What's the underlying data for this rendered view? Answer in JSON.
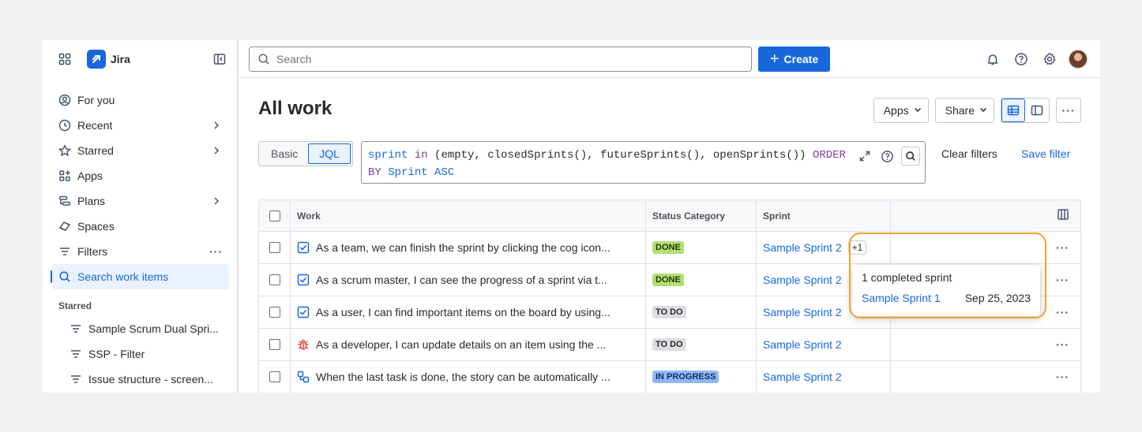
{
  "sidebar": {
    "app_name": "Jira",
    "nav": [
      {
        "label": "For you",
        "icon": "user-circle-icon"
      },
      {
        "label": "Recent",
        "icon": "clock-icon"
      },
      {
        "label": "Starred",
        "icon": "star-icon"
      },
      {
        "label": "Apps",
        "icon": "apps-icon"
      },
      {
        "label": "Plans",
        "icon": "plans-icon"
      },
      {
        "label": "Spaces",
        "icon": "spaces-icon"
      },
      {
        "label": "Filters",
        "icon": "filter-icon"
      },
      {
        "label": "Search work items",
        "icon": "search-icon"
      }
    ],
    "starred_heading": "Starred",
    "starred_items": [
      "Sample Scrum Dual Spri...",
      "SSP - Filter",
      "Issue structure - screen..."
    ]
  },
  "topbar": {
    "search_placeholder": "Search",
    "create_label": "Create"
  },
  "page": {
    "title": "All work",
    "apps_label": "Apps",
    "share_label": "Share"
  },
  "query": {
    "basic_label": "Basic",
    "jql_label": "JQL",
    "jql_kw1": "sprint",
    "jql_op1": "in",
    "jql_mid": "(empty, closedSprints(), futureSprints(), openSprints())",
    "jql_op2": "ORDER",
    "jql_op3": "BY",
    "jql_kw2": "Sprint",
    "jql_kw3": "ASC",
    "clear_filters": "Clear filters",
    "save_filter": "Save filter"
  },
  "table": {
    "headers": {
      "work": "Work",
      "status": "Status Category",
      "sprint": "Sprint"
    },
    "rows": [
      {
        "type": "task",
        "summary": "As a team, we can finish the sprint by clicking the cog icon...",
        "status": "DONE",
        "sprint": "Sample Sprint 2",
        "extra": "+1"
      },
      {
        "type": "task",
        "summary": "As a scrum master, I can see the progress of a sprint via t...",
        "status": "DONE",
        "sprint": "Sample Sprint 2"
      },
      {
        "type": "task",
        "summary": "As a user, I can find important items on the board by using...",
        "status": "TO DO",
        "sprint": "Sample Sprint 2"
      },
      {
        "type": "bug",
        "summary": "As a developer, I can update details on an item using the ...",
        "status": "TO DO",
        "sprint": "Sample Sprint 2"
      },
      {
        "type": "subtask",
        "summary": "When the last task is done, the story can be automatically ...",
        "status": "IN PROGRESS",
        "sprint": "Sample Sprint 2"
      }
    ]
  },
  "popup": {
    "title": "1 completed sprint",
    "sprint": "Sample Sprint 1",
    "date": "Sep 25, 2023"
  },
  "colors": {
    "accent": "#1868db",
    "highlight": "#f5a22a",
    "done": "#b3df72",
    "todo": "#dddee1",
    "in_progress": "#8fb8f6"
  }
}
